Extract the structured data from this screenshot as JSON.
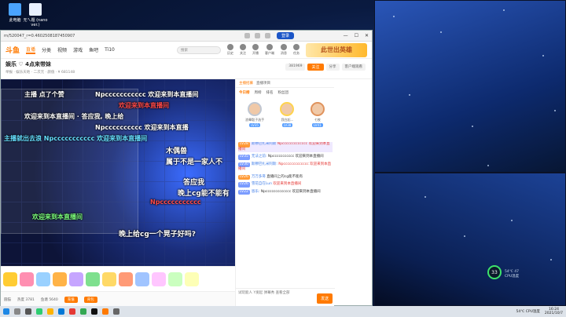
{
  "desktop": {
    "icons": [
      {
        "label": "此电脑",
        "color": "#4aa3ff"
      },
      {
        "label": "无ㄟ题 (nano ver.)",
        "color": "#e8f0ff"
      }
    ],
    "side_badge": "直播",
    "gadget": {
      "percent": "33",
      "temp": "54℃ 47",
      "label": "CPU温度"
    }
  },
  "browser": {
    "url": "rn/520047_r=0.4602508187450907",
    "login": "登录",
    "win_controls": [
      "—",
      "☐",
      "✕"
    ]
  },
  "site": {
    "logo": "斗鱼",
    "nav": [
      "直播",
      "分类",
      "视频",
      "游戏",
      "鱼吧",
      "Ti10"
    ],
    "active_nav": "直播",
    "search_placeholder": "搜索",
    "top_icons": [
      "历史",
      "关注",
      "开播",
      "客户端",
      "消息",
      "任务"
    ],
    "banner": "此世出英雄"
  },
  "room": {
    "title": "娱乐 ♡ 4点来带妹",
    "meta": "举报 · 娱乐天地 · 二次元 · 颜值  ·  ¥ 681148",
    "follow_count": "381969",
    "follow_label": "关注",
    "share": "分享",
    "client": "客户端观看"
  },
  "danmaku": [
    {
      "text": "主播 点了个赞",
      "color": "white",
      "top": 0
    },
    {
      "text": "Npccccccccccc 欢迎来到本直播间",
      "color": "white",
      "top": 0
    },
    {
      "text": "欢迎来到本直播间",
      "color": "red",
      "top": 0
    },
    {
      "text": "欢迎来到本直播间 · 答应我, 晚上给",
      "color": "white",
      "top": 0
    },
    {
      "text": "Npcccccccccc 欢迎来到本直播",
      "color": "white",
      "top": 0
    },
    {
      "text": "主播就出去浪 Npccccccccccc 欢迎来到本直播间",
      "color": "cyan",
      "top": 0
    },
    {
      "text": "木偶兽",
      "color": "white",
      "top": 0
    },
    {
      "text": "属于不是一家人不",
      "color": "white",
      "top": 0
    },
    {
      "text": "答应我",
      "color": "white",
      "top": 0
    },
    {
      "text": "晚上cg能不能有",
      "color": "white",
      "top": 0
    },
    {
      "text": "Npccccccccccc",
      "color": "red",
      "top": 0
    },
    {
      "text": "晚上给cg一个晃子好吗?",
      "color": "white",
      "top": 0
    },
    {
      "text": "欢迎来到本直播间",
      "color": "green",
      "top": 0
    }
  ],
  "player_bottom": {
    "items": [
      "圆猫",
      "热度 3781",
      "鱼塘 5640"
    ],
    "btn1": "充值",
    "btn2": "背包"
  },
  "panel": {
    "tabs": [
      "主播招募",
      "直播项目"
    ],
    "subtabs": [
      "今日榜",
      "周榜",
      "排名",
      "粉丝团"
    ],
    "rank": [
      {
        "name": "浪晕骰子选手",
        "level": "LV35",
        "medal": "silver"
      },
      {
        "name": "我白起...",
        "level": "LV38",
        "medal": "gold"
      },
      {
        "name": "七夜",
        "level": "LV41",
        "medal": "copper"
      }
    ],
    "messages": [
      {
        "tag": "LV28",
        "name": "斯穆巴扎米阿斯",
        "text": "Npccccccccccccc 欢迎来到本直播间",
        "hl": true
      },
      {
        "tag": "LV35",
        "name": "无法之前:",
        "text": "Npccccccccccc 欢迎来到本直播间",
        "hl": false
      },
      {
        "tag": "LV30",
        "name": "斯穆巴扎米阿斯:",
        "text": "Npccccccccccccc 欢迎来到本直播间",
        "hl": false
      },
      {
        "tag": "LV26",
        "name": "万万多哥 ",
        "text": "直播间上的cg能不能有",
        "hl": false
      },
      {
        "tag": "LV26",
        "name": "雪花自在Lun",
        "text": "欢迎来到本直播间",
        "hl": false
      },
      {
        "tag": "LV22",
        "name": "恩乐:",
        "text": "Npccccccccccccc 欢迎来到本直播间",
        "hl": false
      }
    ],
    "input_tools": [
      "试玩能人",
      "Y发起",
      "弹幕秀",
      "查看全部"
    ],
    "send": "发送"
  },
  "taskbar": {
    "time": "16:24",
    "date": "2021/10/7",
    "weather": "54℃ CPU温度"
  },
  "colors": {
    "accent": "#ff7a00",
    "brand_blue": "#1c56c7"
  }
}
